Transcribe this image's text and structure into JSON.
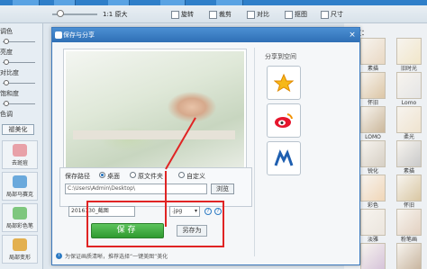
{
  "toolbar": {
    "zoom_label": "1:1 原大",
    "rotate_label": "旋转",
    "crop_label": "裁剪",
    "contrast_label": "对比",
    "cutout_label": "抠图",
    "size_label": "尺寸"
  },
  "left_panel": {
    "labels": [
      "调色",
      "亮度",
      "对比度",
      "饱和度",
      "色温",
      "色调"
    ],
    "button": "褪美化",
    "tools": [
      {
        "label": "去斑痘",
        "color": "#e8a1a8"
      },
      {
        "label": "局部马赛克",
        "color": "#6aa9dc"
      },
      {
        "label": "局部彩色笔",
        "color": "#7ec77e"
      },
      {
        "label": "局部变形",
        "color": "#e3b04f"
      }
    ]
  },
  "right_panel": {
    "title": "特效：",
    "captions": [
      "素描",
      "旧时光",
      "怀旧",
      "Lomo",
      "LOMO",
      "柔光",
      "锐化",
      "素描",
      "彩色",
      "怀旧",
      "淡雅",
      "粉笔画",
      "紫调",
      "古典"
    ]
  },
  "dialog": {
    "title": "保存与分享",
    "close": "×",
    "share_label": "分享到空间",
    "share_icons": [
      "qzone-icon",
      "weibo-icon",
      "renren-icon"
    ],
    "save_path_label": "保存路径",
    "radio_desktop": "桌面",
    "radio_original": "原文件夹",
    "radio_custom": "自定义",
    "path_value": "C:\\Users\\Admin\\Desktop\\",
    "browse_label": "浏览",
    "filename_value": "2016130_截图",
    "format_value": ".jpg",
    "save_label": "保存",
    "save_as_label": "另存为",
    "footer_note": "为保证画质清晰，推荐选择“一键美图”美化",
    "colors": {
      "title_bar": "#2f6fb5",
      "save_button": "#3aa63a",
      "highlight": "#e02424"
    }
  }
}
